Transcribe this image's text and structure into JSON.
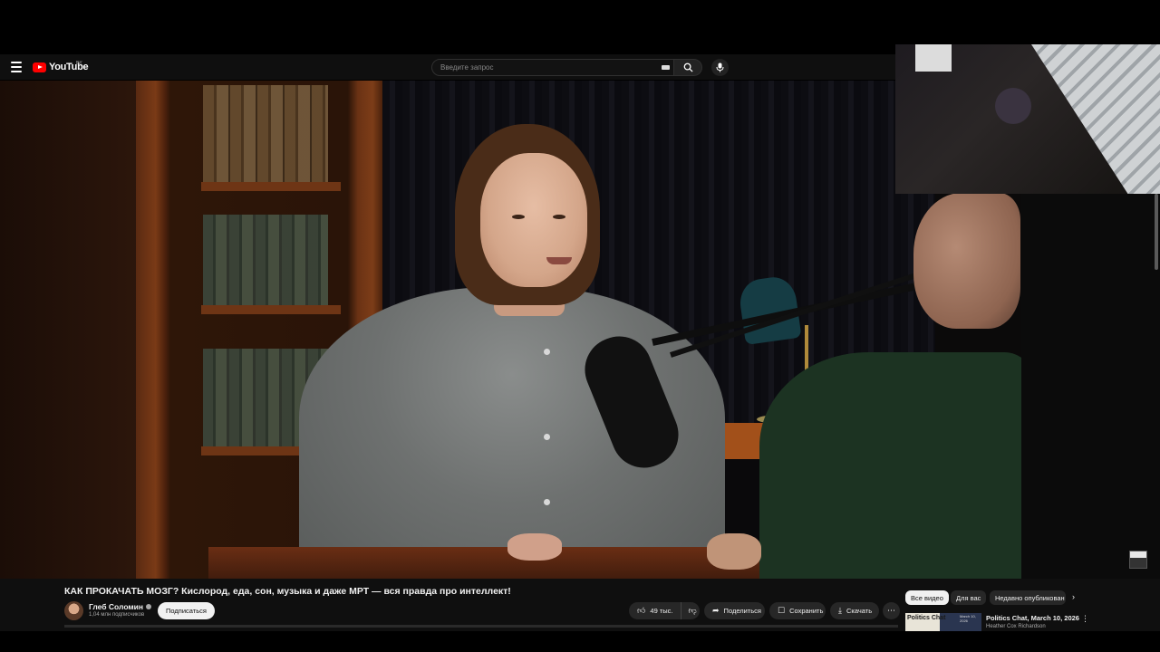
{
  "header": {
    "logo_text": "YouTube",
    "region": "BY",
    "search_placeholder": "Введите запрос"
  },
  "video": {
    "title": "КАК ПРОКАЧАТЬ МОЗГ? Кислород, еда, сон, музыка и даже МРТ — вся правда про интеллект!"
  },
  "channel": {
    "name": "Глеб Соломин",
    "subscribers": "1,04 млн подписчиков",
    "subscribe_label": "Подписаться"
  },
  "actions": {
    "like_count": "49 тыс.",
    "share_label": "Поделиться",
    "save_label": "Сохранить",
    "download_label": "Скачать"
  },
  "chips": [
    "Все видео",
    "Для вас",
    "Недавно опубликован"
  ],
  "recommended": [
    {
      "thumb_text": "Politics Chat",
      "thumb_date": "March 10, 2026",
      "title": "Politics Chat, March 10, 2026",
      "channel": "Heather Cox Richardson"
    }
  ],
  "icons": {
    "menu": "menu-icon",
    "search": "search-icon",
    "mic": "mic-icon",
    "like": "thumbs-up-icon",
    "dislike": "thumbs-down-icon",
    "share": "share-icon",
    "save": "save-icon",
    "download": "download-icon",
    "more": "more-icon"
  },
  "colors": {
    "brand": "#ff0000",
    "background": "#0f0f0f",
    "pill": "#272727"
  }
}
